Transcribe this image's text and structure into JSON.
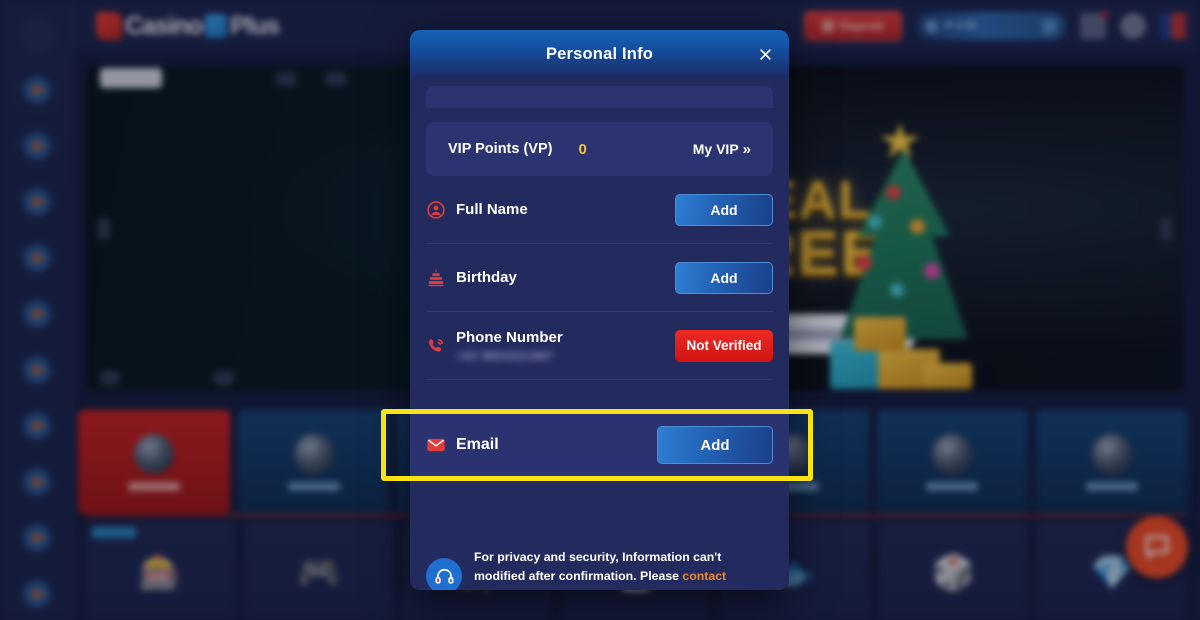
{
  "header": {
    "logo_part1": "Casino",
    "logo_part2": "Plus",
    "deposit_label": "Deposit",
    "wallet_balance": "₱ 0.00",
    "icons": [
      "messages-icon",
      "account-icon",
      "language-flag-icon"
    ]
  },
  "sidebar": {
    "item_count": 10,
    "top_icon": "menu-toggle-icon"
  },
  "banner": {
    "headline_line1": "REAL",
    "headline_line2": "FREE",
    "cta_label": "GET NOW"
  },
  "categories": [
    {
      "label": "Slots",
      "active": true
    },
    {
      "label": "Casino",
      "active": false
    },
    {
      "label": "Live",
      "active": false
    },
    {
      "label": "Poker",
      "active": false
    },
    {
      "label": "Fishing",
      "active": false
    },
    {
      "label": "Sports",
      "active": false
    },
    {
      "label": "Arcade",
      "active": false
    }
  ],
  "chat": {
    "icon": "chat-bubble-icon"
  },
  "modal": {
    "title": "Personal Info",
    "close_icon": "close-icon",
    "vip": {
      "label": "VIP Points (VP)",
      "value": "0",
      "link_label": "My VIP",
      "link_chevron": "»"
    },
    "rows": [
      {
        "icon": "user-circle-icon",
        "label": "Full Name",
        "sub": "",
        "action_type": "button",
        "action_label": "Add"
      },
      {
        "icon": "birthday-cake-icon",
        "label": "Birthday",
        "sub": "",
        "action_type": "button",
        "action_label": "Add"
      },
      {
        "icon": "phone-icon",
        "label": "Phone Number",
        "sub": "+63 9654321987",
        "action_type": "badge",
        "action_label": "Not Verified"
      }
    ],
    "email_row": {
      "icon": "envelope-icon",
      "label": "Email",
      "action_label": "Add",
      "highlighted": true,
      "highlight_color": "#f8e316"
    },
    "note": {
      "icon": "headset-icon",
      "text_part1": "For privacy and security, Information can't modified after confirmation. Please ",
      "link_label": "contact customer service",
      "text_part2": "."
    }
  },
  "colors": {
    "modal_bg": "#232a5e",
    "modal_header_blue": "#1862b8",
    "accent_red": "#e23b3b",
    "accent_gold": "#f0c33c",
    "accent_orange": "#e8892b",
    "highlight_yellow": "#f8e316",
    "not_verified_red": "#ef2a26",
    "chat_orange": "#e8481f"
  }
}
